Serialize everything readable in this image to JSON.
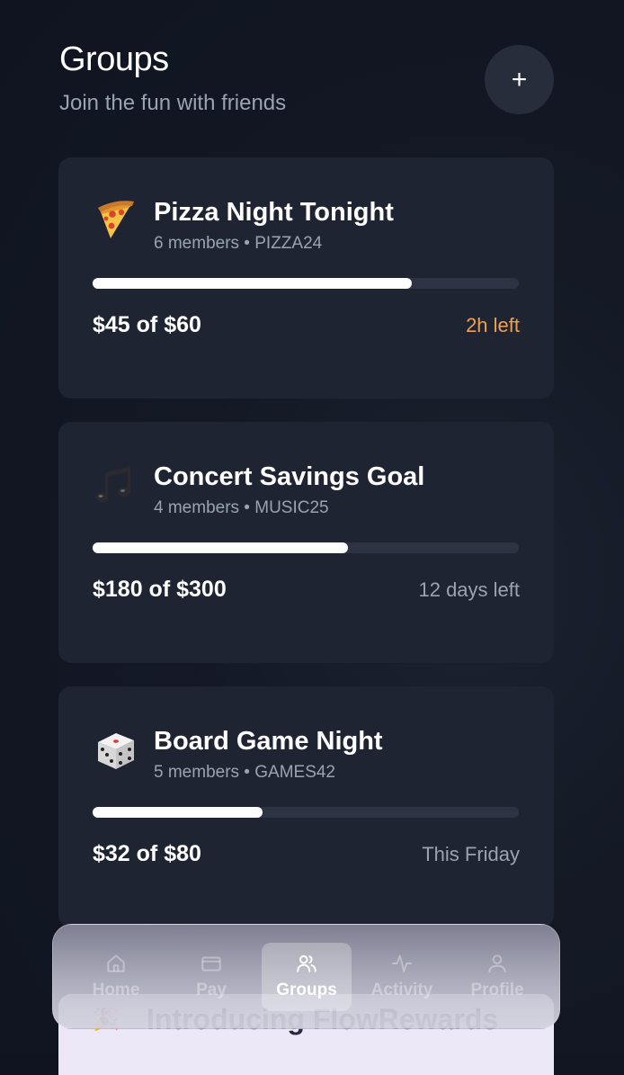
{
  "header": {
    "title": "Groups",
    "subtitle": "Join the fun with friends",
    "add_label": "+"
  },
  "groups": [
    {
      "icon": "pizza-emoji",
      "name": "Pizza Night Tonight",
      "meta": "6 members • PIZZA24",
      "progress": 0.75,
      "amount": "$45 of $60",
      "time": "2h left",
      "time_color": "#f0a050"
    },
    {
      "icon": "music-notes-emoji",
      "name": "Concert Savings Goal",
      "meta": "4 members • MUSIC25",
      "progress": 0.6,
      "amount": "$180 of $300",
      "time": "12 days left"
    },
    {
      "icon": "dice-emoji",
      "name": "Board Game Night",
      "meta": "5 members • GAMES42",
      "progress": 0.4,
      "amount": "$32 of $80",
      "time": "This Friday"
    }
  ],
  "promo": {
    "text": "Introducing FlowRewards"
  },
  "nav": {
    "items": [
      {
        "label": "Home",
        "icon": "home-icon"
      },
      {
        "label": "Pay",
        "icon": "card-icon"
      },
      {
        "label": "Groups",
        "icon": "users-icon",
        "active": true
      },
      {
        "label": "Activity",
        "icon": "activity-icon"
      },
      {
        "label": "Profile",
        "icon": "profile-icon"
      }
    ]
  }
}
